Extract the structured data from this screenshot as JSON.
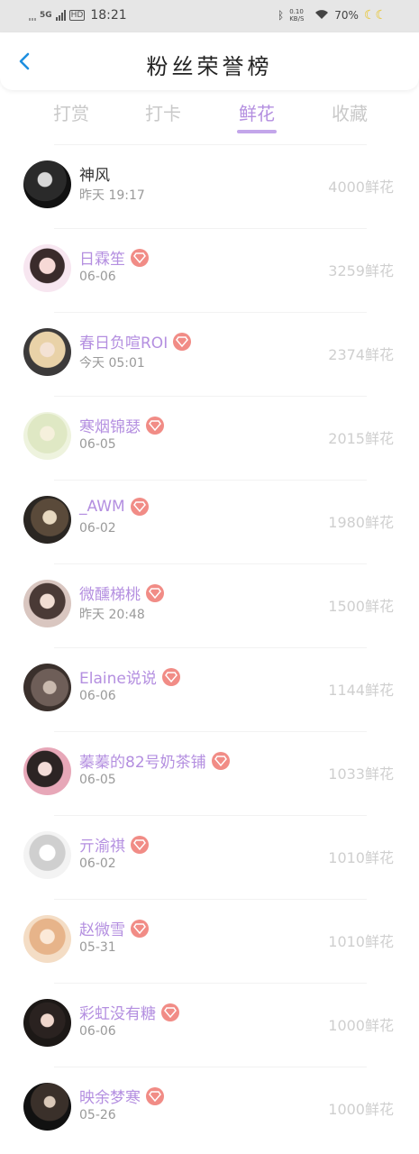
{
  "status_bar": {
    "network": "5G",
    "hd": "HD",
    "time": "18:21",
    "bt": "ᛒ",
    "data_rate": "0.10 KB/S",
    "battery": "70%",
    "moon": "☾☾"
  },
  "header": {
    "title": "粉丝荣誉榜",
    "back_icon": "chevron-left-icon"
  },
  "tabs": [
    {
      "label": "打赏",
      "active": false
    },
    {
      "label": "打卡",
      "active": false
    },
    {
      "label": "鲜花",
      "active": true
    },
    {
      "label": "收藏",
      "active": false
    }
  ],
  "fans": [
    {
      "name": "神风",
      "date": "昨天 19:17",
      "amount": "4000鲜花",
      "vip": false
    },
    {
      "name": "日霖笙",
      "date": "06-06",
      "amount": "3259鲜花",
      "vip": true
    },
    {
      "name": "春日负喧ROI",
      "date": "今天 05:01",
      "amount": "2374鲜花",
      "vip": true
    },
    {
      "name": "寒烟锦瑟",
      "date": "06-05",
      "amount": "2015鲜花",
      "vip": true
    },
    {
      "name": "_AWM",
      "date": "06-02",
      "amount": "1980鲜花",
      "vip": true
    },
    {
      "name": "微醺梯桃",
      "date": "昨天 20:48",
      "amount": "1500鲜花",
      "vip": true
    },
    {
      "name": "Elaine说说",
      "date": "06-06",
      "amount": "1144鲜花",
      "vip": true
    },
    {
      "name": "蓁蓁的82号奶茶铺",
      "date": "06-05",
      "amount": "1033鲜花",
      "vip": true
    },
    {
      "name": "亓渝祺",
      "date": "06-02",
      "amount": "1010鲜花",
      "vip": true
    },
    {
      "name": "赵微雪",
      "date": "05-31",
      "amount": "1010鲜花",
      "vip": true
    },
    {
      "name": "彩虹没有糖",
      "date": "06-06",
      "amount": "1000鲜花",
      "vip": true
    },
    {
      "name": "映余梦寒",
      "date": "05-26",
      "amount": "1000鲜花",
      "vip": true
    }
  ],
  "colors": {
    "accent": "#b48fe0",
    "badge": "#f18c86",
    "muted": "#cfcfcf"
  }
}
